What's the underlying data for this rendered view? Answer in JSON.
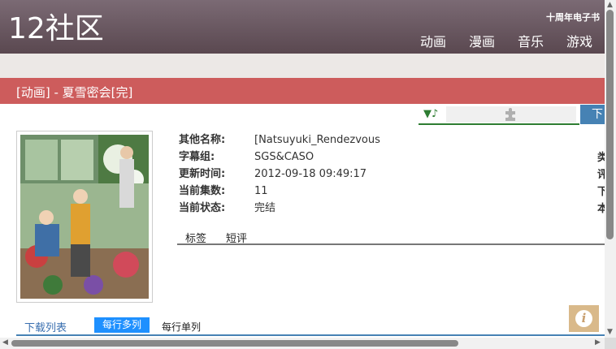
{
  "header": {
    "site_title": "12社区",
    "promo": "十周年电子书",
    "nav": [
      "动画",
      "漫画",
      "音乐",
      "游戏"
    ]
  },
  "title_bar": "[动画] - 夏雪密会[完]",
  "player": {
    "music_icon": "▼♪",
    "plugin_icon": "puzzle-icon"
  },
  "download_tab": "下",
  "info": {
    "rows": [
      {
        "label": "其他名称:",
        "value": "[Natsuyuki_Rendezvous"
      },
      {
        "label": "字幕组:",
        "value": "SGS&CASO"
      },
      {
        "label": "更新时间:",
        "value": "2012-09-18 09:49:17"
      },
      {
        "label": "当前集数:",
        "value": "11"
      },
      {
        "label": "当前状态:",
        "value": "完结"
      }
    ],
    "side_letters": [
      "类",
      "评",
      "下",
      "本"
    ]
  },
  "sub_tabs": [
    "标签",
    "短评"
  ],
  "download_list": {
    "title": "下载列表",
    "multi_label": "每行多列",
    "single_label": "每行单列"
  },
  "info_button": "i",
  "colors": {
    "header": "#5a4850",
    "title_bar": "#cd5c5c",
    "accent_blue": "#1e90ff",
    "player_green": "#2e7d32"
  }
}
